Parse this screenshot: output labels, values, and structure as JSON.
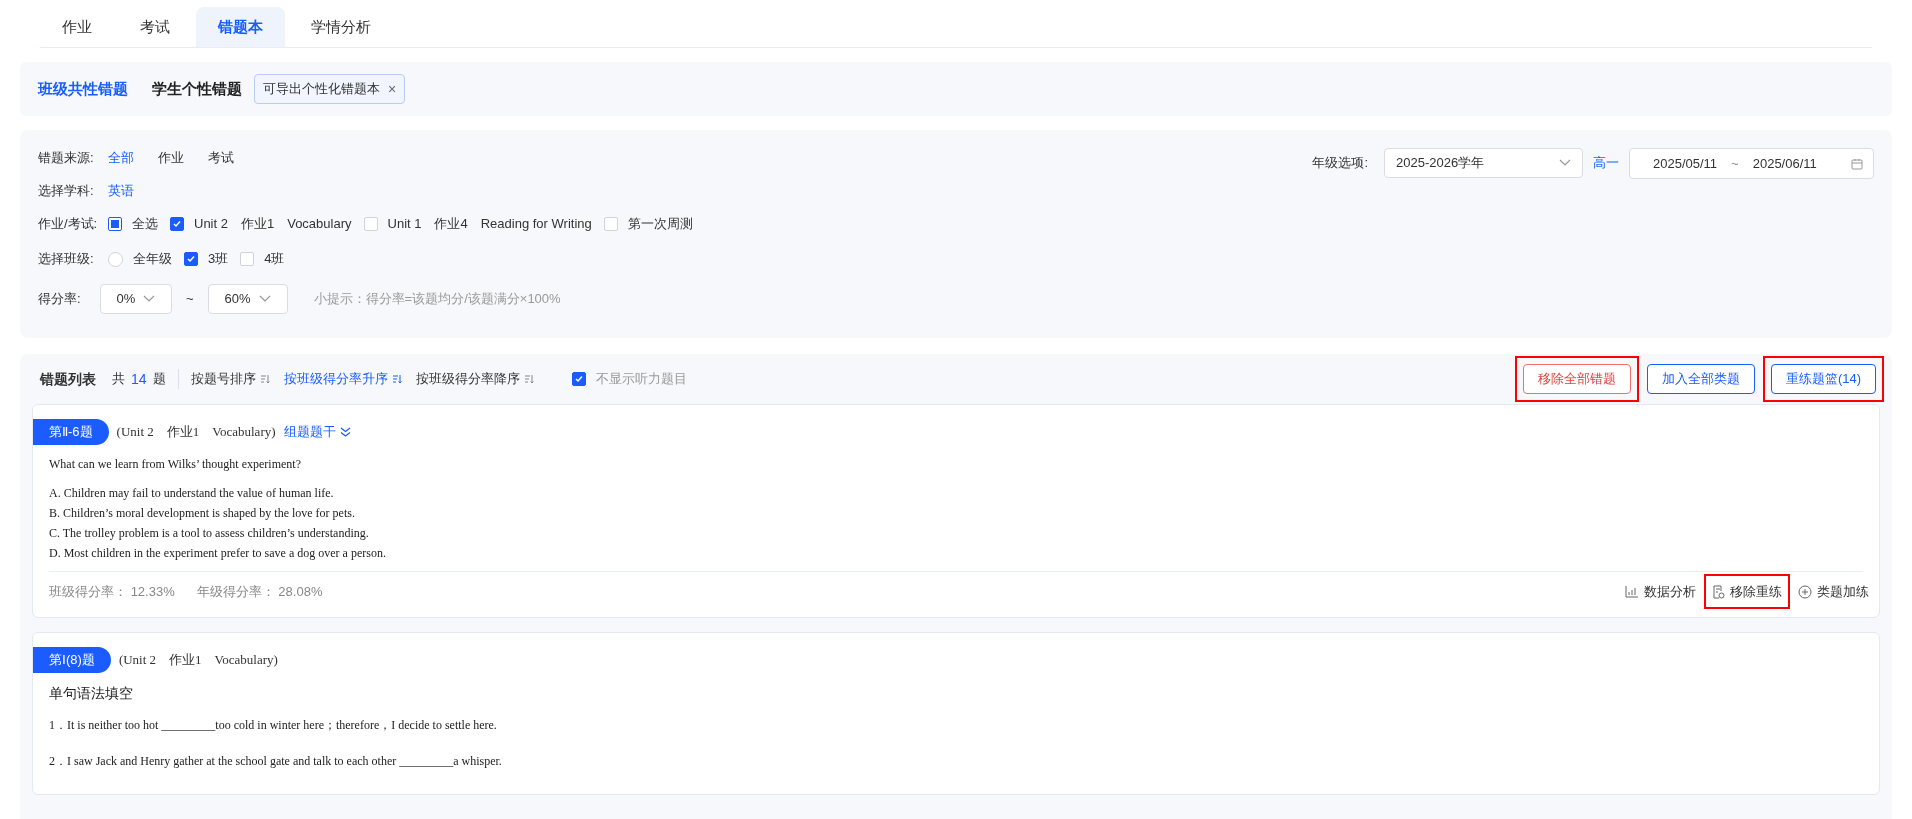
{
  "tabs": [
    {
      "label": "作业",
      "selected": false
    },
    {
      "label": "考试",
      "selected": false
    },
    {
      "label": "错题本",
      "selected": true
    },
    {
      "label": "学情分析",
      "selected": false
    }
  ],
  "subtabs": [
    {
      "label": "班级共性错题",
      "selected": true
    },
    {
      "label": "学生个性错题",
      "selected": false
    }
  ],
  "export_tag": {
    "label": "可导出个性化错题本",
    "close": "×"
  },
  "filters": {
    "source": {
      "label": "错题来源:",
      "options": [
        {
          "label": "全部",
          "selected": true
        },
        {
          "label": "作业",
          "selected": false
        },
        {
          "label": "考试",
          "selected": false
        }
      ]
    },
    "subject": {
      "label": "选择学科:",
      "options": [
        {
          "label": "英语",
          "selected": true
        }
      ]
    },
    "assignments": {
      "label": "作业/考试:",
      "options": [
        {
          "label": "全选",
          "checked": false,
          "indeterminate": true
        },
        {
          "label": "Unit 2　作业1　Vocabulary",
          "checked": true
        },
        {
          "label": "Unit 1　作业4　Reading for Writing",
          "checked": false
        },
        {
          "label": "第一次周测",
          "checked": false
        }
      ]
    },
    "classes": {
      "label": "选择班级:",
      "options": [
        {
          "kind": "radio",
          "label": "全年级",
          "checked": false
        },
        {
          "kind": "checkbox",
          "label": "3班",
          "checked": true
        },
        {
          "kind": "checkbox",
          "label": "4班",
          "checked": false
        }
      ]
    },
    "score_rate": {
      "label": "得分率:",
      "from": "0%",
      "separator": "~",
      "to": "60%",
      "hint": "小提示：得分率=该题均分/该题满分×100%"
    },
    "grade": {
      "label": "年级选项:",
      "value": "2025-2026学年",
      "level_link": "高一"
    },
    "date_range": {
      "start": "2025/05/11",
      "separator": "~",
      "end": "2025/06/11"
    }
  },
  "list_header": {
    "title": "错题列表",
    "count_prefix": "共",
    "count": "14",
    "count_suffix": "题",
    "sorts": [
      {
        "label": "按题号排序",
        "selected": false
      },
      {
        "label": "按班级得分率升序",
        "selected": true
      },
      {
        "label": "按班级得分率降序",
        "selected": false
      }
    ],
    "hide_listening": {
      "label": "不显示听力题目",
      "checked": true
    },
    "buttons": [
      {
        "label": "移除全部错题",
        "kind": "danger",
        "highlighted": true
      },
      {
        "label": "加入全部类题",
        "kind": "primary",
        "highlighted": false
      },
      {
        "label": "重练题篮(14)",
        "kind": "primary",
        "highlighted": true
      }
    ]
  },
  "questions": [
    {
      "badge": "第Ⅱ-6题",
      "source": "(Unit 2　作业1　Vocabulary)",
      "stem_link": "组题题干",
      "lines": [
        {
          "kind": "prompt",
          "text": "What can we learn from Wilks’ thought experiment?"
        },
        {
          "kind": "option",
          "text": "A. Children may fail to understand the value of human life."
        },
        {
          "kind": "option",
          "text": "B. Children’s moral development is shaped by the love for pets."
        },
        {
          "kind": "option",
          "text": "C. The trolley problem is a tool to assess children’s understanding."
        },
        {
          "kind": "option",
          "text": "D. Most children in the experiment prefer to save a dog over a person."
        }
      ],
      "stats": [
        {
          "label": "班级得分率：",
          "value": "12.33%"
        },
        {
          "label": "年级得分率：",
          "value": "28.08%"
        }
      ],
      "actions": [
        {
          "kind": "chart",
          "label": "数据分析",
          "highlighted": false
        },
        {
          "kind": "remove",
          "label": "移除重练",
          "highlighted": true
        },
        {
          "kind": "add",
          "label": "类题加练",
          "highlighted": false
        }
      ]
    },
    {
      "badge": "第Ⅰ(8)题",
      "source": "(Unit 2　作业1　Vocabulary)",
      "lines": [
        {
          "kind": "heading",
          "text": "单句语法填空"
        },
        {
          "kind": "item",
          "text": "1．It is neither too hot _________too cold in winter here；therefore，I decide to settle here."
        },
        {
          "kind": "item",
          "text": "2．I saw Jack and Henry gather at the school gate and talk to each other _________a whisper."
        }
      ]
    }
  ]
}
